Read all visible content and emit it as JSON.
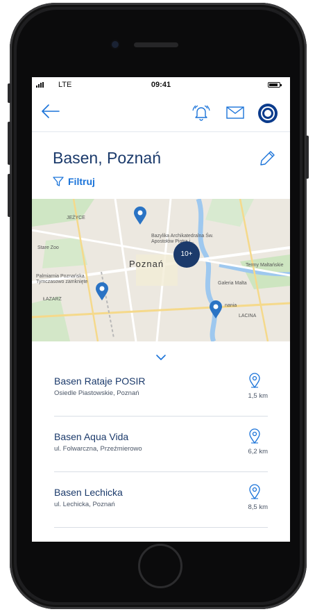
{
  "status_bar": {
    "carrier": "LTE",
    "time": "09:41"
  },
  "header": {
    "title": "Basen, Poznań",
    "filter_label": "Filtruj"
  },
  "map": {
    "city_label": "Poznań",
    "cluster_label": "10+",
    "labels": {
      "jezyce": "JEŻYCE",
      "zoo": "Stare Zoo",
      "basilica": "Bazylika Archikatedralna Św. Apostołów Piotra i...",
      "palmiarnia": "Palmiarnia Poznańska\nTymczasowo zamknięte",
      "lazarz": "ŁAZARZ",
      "malta_terms": "Termy Maltańskie",
      "galeria_malta": "Galeria Malta",
      "lacina": "LACINA",
      "poznania": "nania"
    }
  },
  "results": [
    {
      "name": "Basen Rataje POSIR",
      "address": "Osiedle Piastowskie, Poznań",
      "distance": "1,5 km"
    },
    {
      "name": "Basen Aqua Vida",
      "address": "ul. Folwarczna, Przeźmierowo",
      "distance": "6,2 km"
    },
    {
      "name": "Basen Lechicka",
      "address": "ul. Lechicka, Poznań",
      "distance": "8,5 km"
    }
  ],
  "colors": {
    "primary": "#1b3a6b",
    "accent": "#1a73d9",
    "pin": "#2a73c4"
  },
  "icons": {
    "back": "arrow-left-icon",
    "bell": "bell-icon",
    "mail": "mail-icon",
    "logo": "pzu-logo-icon",
    "edit": "pencil-icon",
    "filter": "filter-icon",
    "location": "location-pin-icon",
    "chevron": "chevron-down-icon"
  }
}
